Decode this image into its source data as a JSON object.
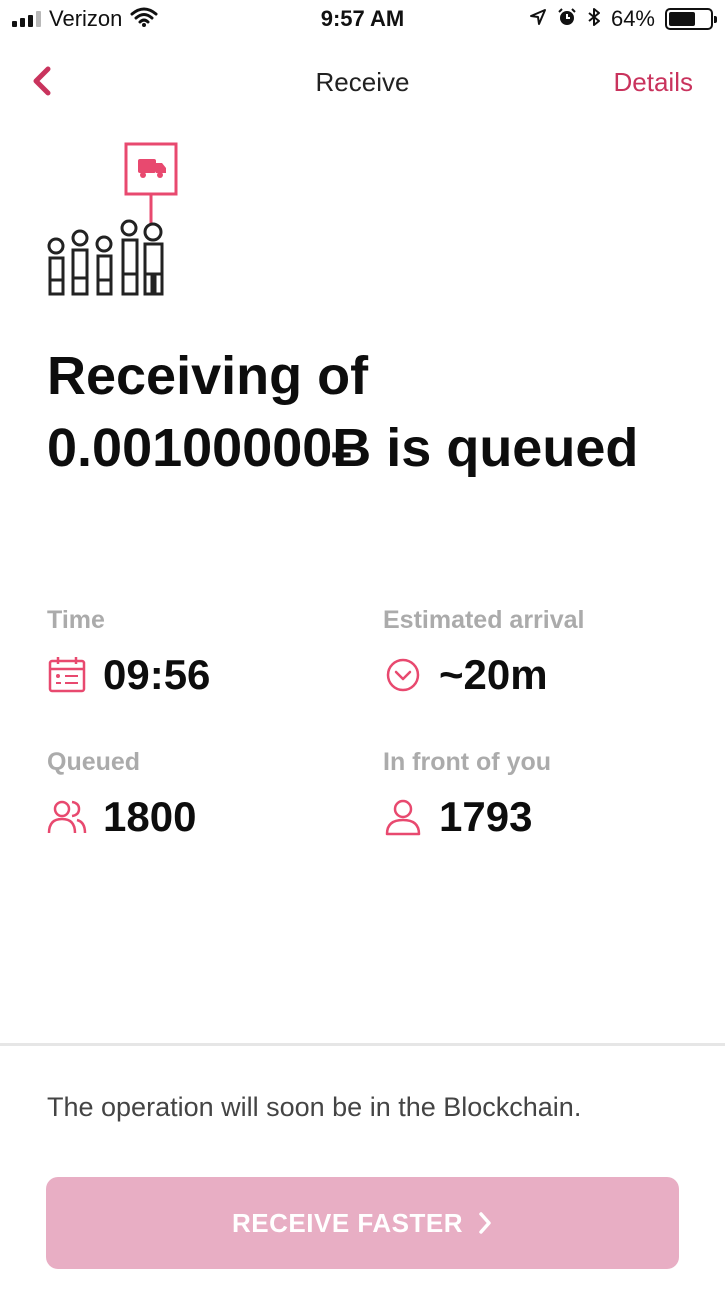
{
  "status_bar": {
    "carrier": "Verizon",
    "time": "9:57 AM",
    "battery_percent": "64%",
    "battery_level": 0.64,
    "icons": [
      "signal-icon",
      "wifi-icon",
      "location-icon",
      "alarm-icon",
      "bluetooth-icon",
      "battery-icon"
    ]
  },
  "nav": {
    "back_icon": "chevron-left-icon",
    "title": "Receive",
    "details_label": "Details"
  },
  "illustration": {
    "icon": "queue-people-truck-icon"
  },
  "headline": {
    "text": "Receiving of 0.00100000Ƀ is queued"
  },
  "stats": {
    "time": {
      "label": "Time",
      "value": "09:56",
      "icon": "calendar-icon"
    },
    "estimated_arrival": {
      "label": "Estimated arrival",
      "value": "~20m",
      "icon": "clock-chevron-icon"
    },
    "queued": {
      "label": "Queued",
      "value": "1800",
      "icon": "users-icon"
    },
    "in_front": {
      "label": "In front of you",
      "value": "1793",
      "icon": "user-icon"
    }
  },
  "footer": {
    "message": "The operation will soon be in the Blockchain.",
    "cta_label": "RECEIVE FASTER",
    "cta_icon": "chevron-right-icon"
  },
  "colors": {
    "accent": "#c9335d",
    "icon_pink": "#e8496f",
    "cta_background": "#e8aec4",
    "label_gray": "#ababab"
  }
}
